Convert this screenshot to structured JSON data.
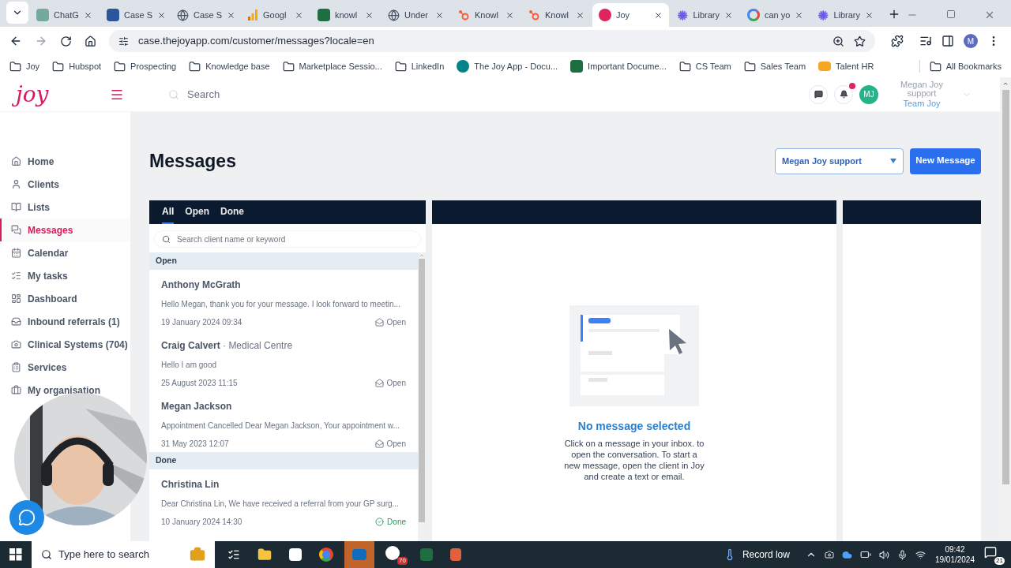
{
  "browser": {
    "tabs": [
      {
        "kind": "chatgpt",
        "label": "ChatG",
        "selected": false
      },
      {
        "kind": "word",
        "label": "Case S",
        "selected": false
      },
      {
        "kind": "globe",
        "label": "Case S",
        "selected": false
      },
      {
        "kind": "analytics",
        "label": "Googl",
        "selected": false
      },
      {
        "kind": "excel",
        "label": "knowl",
        "selected": false
      },
      {
        "kind": "globe",
        "label": "Under",
        "selected": false
      },
      {
        "kind": "hubspot",
        "label": "Knowl",
        "selected": false
      },
      {
        "kind": "hubspot",
        "label": "Knowl",
        "selected": false
      },
      {
        "kind": "joy",
        "label": "Joy",
        "selected": true
      },
      {
        "kind": "asterisk",
        "label": "Library",
        "selected": false
      },
      {
        "kind": "google",
        "label": "can yo",
        "selected": false
      },
      {
        "kind": "asterisk",
        "label": "Library",
        "selected": false
      }
    ],
    "url": "case.thejoyapp.com/customer/messages?locale=en",
    "profile": "M",
    "bookmarks": [
      {
        "kind": "folder",
        "label": "Joy"
      },
      {
        "kind": "folder",
        "label": "Hubspot"
      },
      {
        "kind": "folder",
        "label": "Prospecting"
      },
      {
        "kind": "folder",
        "label": "Knowledge base"
      },
      {
        "kind": "folder",
        "label": "Marketplace Sessio..."
      },
      {
        "kind": "folder",
        "label": "LinkedIn"
      },
      {
        "kind": "sharepoint",
        "label": "The Joy App - Docu..."
      },
      {
        "kind": "excel",
        "label": "Important Docume..."
      },
      {
        "kind": "folder",
        "label": "CS Team"
      },
      {
        "kind": "folder",
        "label": "Sales Team"
      },
      {
        "kind": "hr",
        "label": "Talent HR"
      }
    ],
    "all_bookmarks": "All Bookmarks"
  },
  "app": {
    "logo": "joy",
    "search": {
      "placeholder": "Search"
    },
    "avatar": "MJ",
    "user_name": "Megan Joy support",
    "team": "Team Joy",
    "notification": true
  },
  "sidebar": {
    "items": [
      {
        "label": "Home",
        "selected": false
      },
      {
        "label": "Clients",
        "selected": false
      },
      {
        "label": "Lists",
        "selected": false
      },
      {
        "label": "Messages",
        "selected": true
      },
      {
        "label": "Calendar",
        "selected": false
      },
      {
        "label": "My tasks",
        "selected": false
      },
      {
        "label": "Dashboard",
        "selected": false
      },
      {
        "label": "Inbound referrals (1)",
        "selected": false
      },
      {
        "label": "Clinical Systems (704)",
        "selected": false
      },
      {
        "label": "Services",
        "selected": false
      },
      {
        "label": "My organisation",
        "selected": false
      }
    ]
  },
  "page": {
    "title": "Messages",
    "inbox_select": "Megan Joy support",
    "new_button": "New Message"
  },
  "inbox": {
    "tabs": [
      {
        "label": "All",
        "selected": true
      },
      {
        "label": "Open",
        "selected": false
      },
      {
        "label": "Done",
        "selected": false
      }
    ],
    "search": {
      "placeholder": "Search client name or keyword"
    },
    "groups": [
      {
        "title": "Open",
        "messages": [
          {
            "name": "Anthony McGrath",
            "preview": "Hello Megan, thank you for your message. I look forward to meetin...",
            "date": "19 January 2024 09:34",
            "status": "Open",
            "kind": "open"
          },
          {
            "name": "Craig Calvert",
            "org": "· Medical Centre",
            "preview": "Hello I am good",
            "date": "25 August 2023 11:15",
            "status": "Open",
            "kind": "open"
          },
          {
            "name": "Megan Jackson",
            "preview": "Appointment Cancelled Dear Megan Jackson, Your appointment w...",
            "date": "31 May 2023 12:07",
            "status": "Open",
            "kind": "open"
          }
        ]
      },
      {
        "title": "Done",
        "messages": [
          {
            "name": "Christina Lin",
            "preview": "Dear Christina Lin, We have received a referral from your GP surg...",
            "date": "10 January 2024 14:30",
            "status": "Done",
            "kind": "done"
          }
        ]
      }
    ]
  },
  "empty_state": {
    "title": "No message selected",
    "text": "Click on a message in your inbox. to open the conversation. To start a new message, open the client in Joy and create a text or email."
  },
  "taskbar": {
    "search": {
      "placeholder": "Type here to search"
    },
    "badge": "70",
    "weather": "Record low",
    "time": "09:42",
    "date": "19/01/2024",
    "notifications": "21"
  }
}
